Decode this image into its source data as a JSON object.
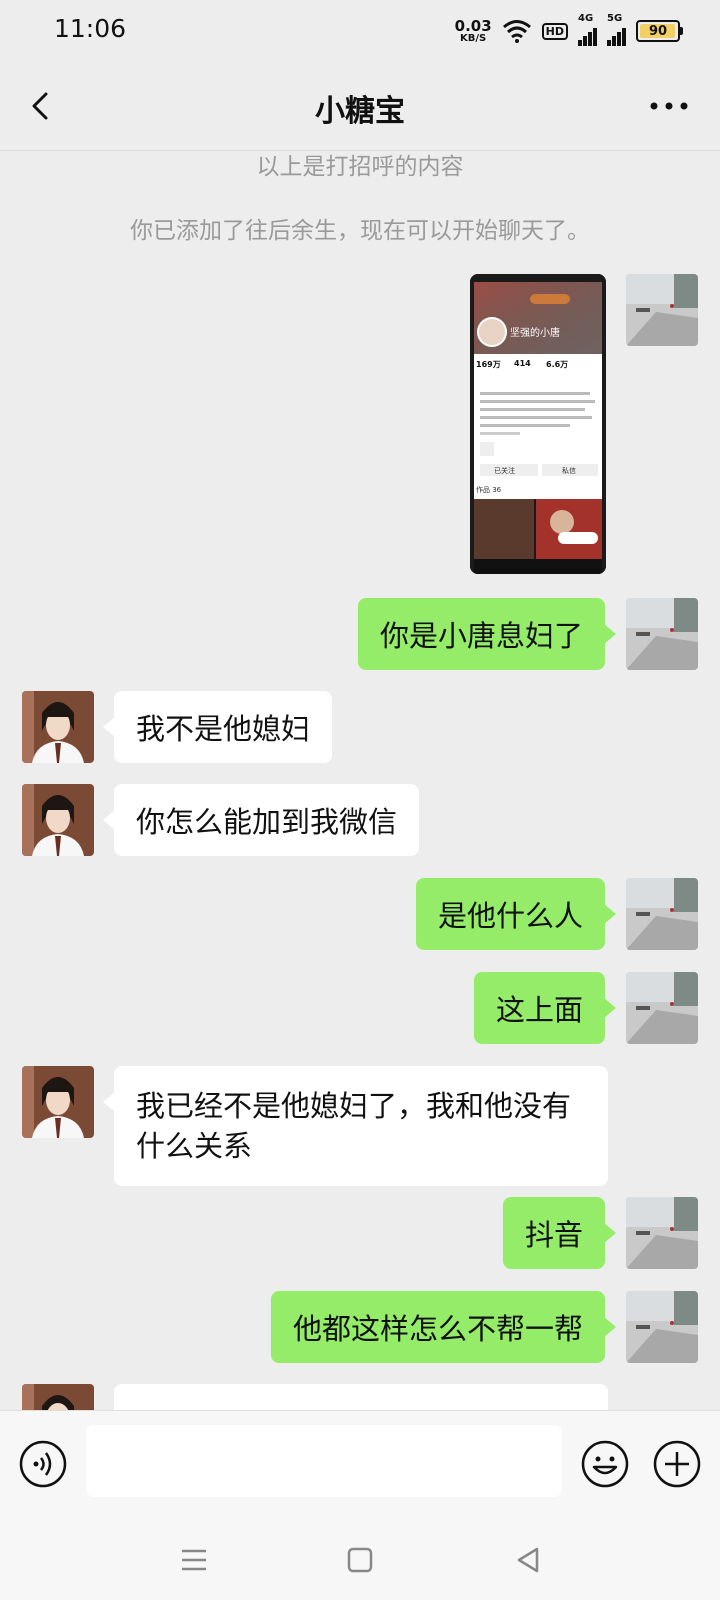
{
  "status_bar": {
    "time": "11:06",
    "net_speed_value": "0.03",
    "net_speed_unit": "KB/S",
    "hd_label": "HD",
    "signal_1_label": "4G",
    "signal_2_label": "5G",
    "battery_percent": "90"
  },
  "header": {
    "title": "小糖宝",
    "back_icon": "chevron-left-icon",
    "more_icon": "more-horizontal-icon"
  },
  "system_messages": [
    "以上是打招呼的内容",
    "你已添加了往后余生，现在可以开始聊天了。"
  ],
  "image_message": {
    "profile_name": "坚强的小唐",
    "stats": [
      "169万",
      "414",
      "6.6万"
    ],
    "button_1": "已关注",
    "button_2": "私信",
    "tab_label": "作品 36"
  },
  "messages": [
    {
      "from": "me",
      "text": "你是小唐息妇了"
    },
    {
      "from": "other",
      "text": "我不是他媳妇"
    },
    {
      "from": "other",
      "text": "你怎么能加到我微信"
    },
    {
      "from": "me",
      "text": "是他什么人"
    },
    {
      "from": "me",
      "text": "这上面"
    },
    {
      "from": "other",
      "text": "我已经不是他媳妇了，我和他没有什么关系"
    },
    {
      "from": "me",
      "text": "抖音"
    },
    {
      "from": "me",
      "text": "他都这样怎么不帮一帮"
    }
  ],
  "input_bar": {
    "voice_icon": "voice-icon",
    "emoji_icon": "emoji-icon",
    "plus_icon": "plus-circle-icon",
    "text_value": ""
  },
  "nav_bar": {
    "menu_icon": "menu-icon",
    "home_icon": "home-square-icon",
    "back_icon": "back-triangle-icon"
  },
  "colors": {
    "outgoing_bubble": "#95ec69",
    "incoming_bubble": "#ffffff",
    "background": "#ededed"
  }
}
